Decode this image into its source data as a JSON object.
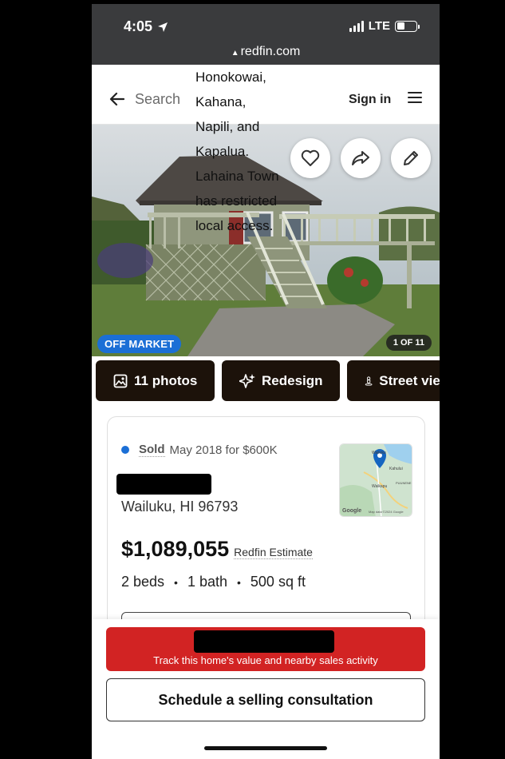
{
  "status_bar": {
    "time": "4:05",
    "network": "LTE",
    "battery_level": 0.4
  },
  "browser": {
    "url": "redfin.com"
  },
  "nav": {
    "search_label": "Search",
    "signin_label": "Sign in"
  },
  "overlay_text": [
    "Honokowai,",
    "Kahana,",
    "Napili, and",
    "Kapalua.",
    "Lahaina Town",
    "has restricted",
    "local access."
  ],
  "hero": {
    "badge": "OFF MARKET",
    "counter": "1 OF 11"
  },
  "thumbs": [
    {
      "label": "11 photos",
      "icon": "image-icon"
    },
    {
      "label": "Redesign",
      "icon": "sparkle-icon"
    },
    {
      "label": "Street view",
      "icon": "pegman-icon"
    }
  ],
  "listing": {
    "sold_label": "Sold",
    "sold_detail": "May 2018 for $600K",
    "city": "Wailuku, HI 96793",
    "price": "$1,089,055",
    "estimate_label": "Redfin Estimate",
    "beds": "2 beds",
    "baths": "1 bath",
    "sqft": "500 sq ft",
    "map": {
      "labels": [
        "Wailuku",
        "Kahului",
        "Waikapu",
        "PUUNENE"
      ],
      "google": "Google",
      "credit": "Map data ©2024 Google"
    }
  },
  "cta": {
    "track_text": "Track this home's value and nearby sales activity",
    "consult_label": "Schedule a selling consultation"
  },
  "colors": {
    "accent": "#d22323",
    "badge_blue": "#1b6fd6"
  }
}
